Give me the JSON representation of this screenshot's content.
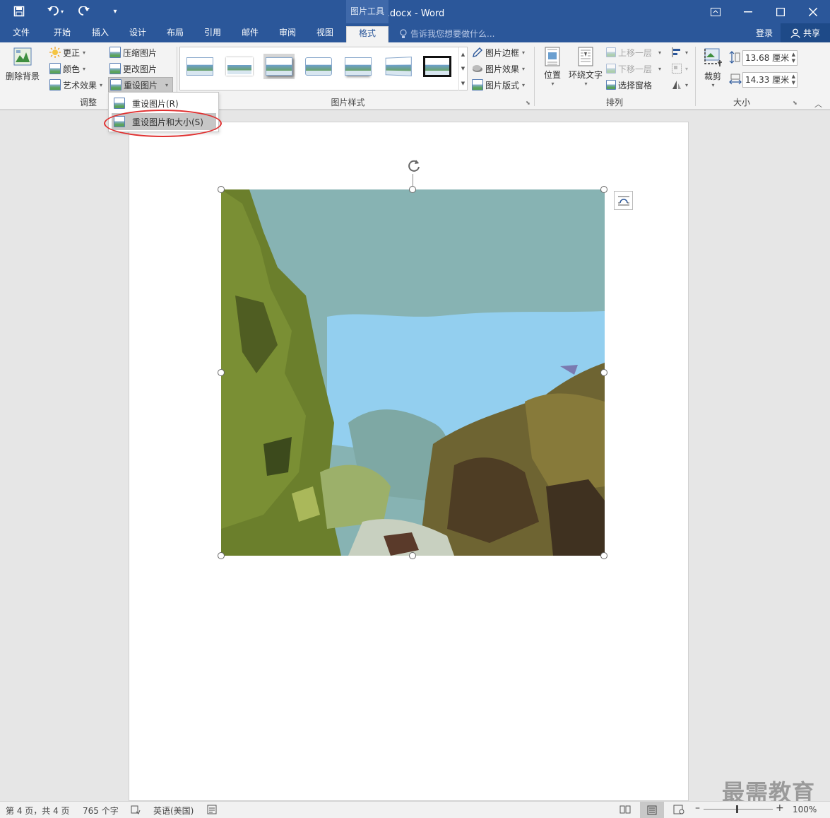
{
  "titlebar": {
    "title": "招聘启事.docx - Word",
    "context_tab": "图片工具",
    "save_icon": "save-icon",
    "undo_icon": "undo-icon",
    "redo_icon": "redo-icon"
  },
  "tabs": [
    {
      "label": "文件"
    },
    {
      "label": "开始"
    },
    {
      "label": "插入"
    },
    {
      "label": "设计"
    },
    {
      "label": "布局"
    },
    {
      "label": "引用"
    },
    {
      "label": "邮件"
    },
    {
      "label": "审阅"
    },
    {
      "label": "视图"
    },
    {
      "label": "格式"
    }
  ],
  "tellme": "告诉我您想要做什么...",
  "login": "登录",
  "share": "共享",
  "ribbon": {
    "remove_bg": "删除背景",
    "corrections": "更正",
    "color": "颜色",
    "artistic": "艺术效果",
    "compress": "压缩图片",
    "change_pic": "更改图片",
    "reset_pic": "重设图片",
    "adjust_label": "调整",
    "styles_label": "图片样式",
    "border": "图片边框",
    "effects": "图片效果",
    "layout": "图片版式",
    "position": "位置",
    "wrap": "环绕文字",
    "bring_forward": "上移一层",
    "send_backward": "下移一层",
    "selection_pane": "选择窗格",
    "arrange_label": "排列",
    "crop": "裁剪",
    "height": "13.68 厘米",
    "width": "14.33 厘米",
    "size_label": "大小"
  },
  "dropdown": {
    "item1": "重设图片(R)",
    "item2": "重设图片和大小(S)"
  },
  "status": {
    "page": "第 4 页，共 4 页",
    "words": "765 个字",
    "lang": "英语(美国)",
    "zoom": "100%"
  },
  "watermark": "最需教育",
  "colors": {
    "ribbon_blue": "#2b579a",
    "highlight": "#e03030"
  }
}
